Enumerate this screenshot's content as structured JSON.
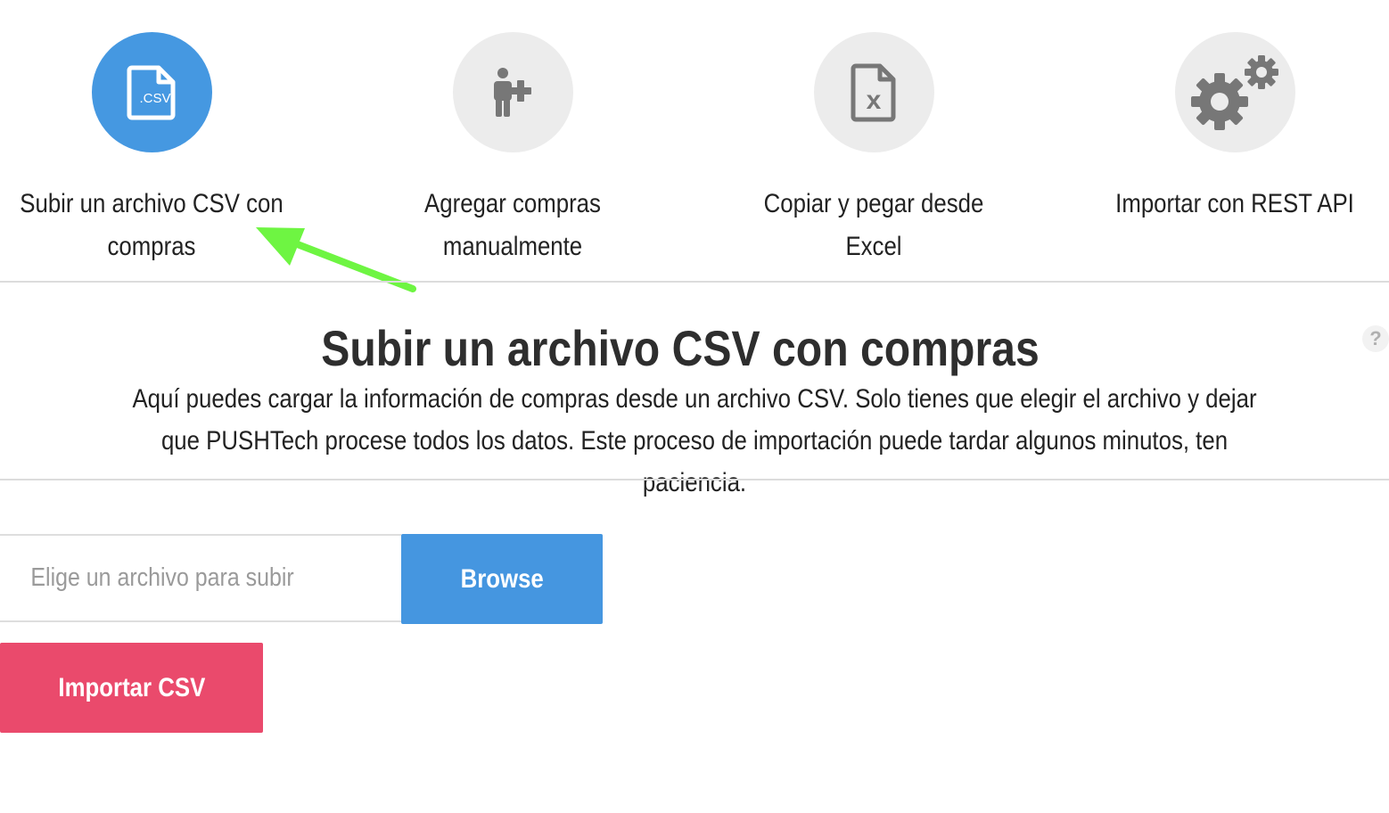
{
  "options": [
    {
      "label": "Subir un archivo CSV con compras",
      "icon": "csv-file-icon",
      "active": true
    },
    {
      "label": "Agregar compras manualmente",
      "icon": "add-user-icon",
      "active": false
    },
    {
      "label": "Copiar y pegar desde Excel",
      "icon": "excel-file-icon",
      "active": false
    },
    {
      "label": "Importar con REST API",
      "icon": "gears-icon",
      "active": false
    }
  ],
  "csv_icon_text": ".CSV",
  "excel_icon_text": "x",
  "section": {
    "title": "Subir un archivo CSV con compras",
    "description": "Aquí puedes cargar la información de compras desde un archivo CSV. Solo tienes que elegir el archivo y dejar que PUSHTech procese todos los datos. Este proceso de importación puede tardar algunos minutos, ten paciencia.",
    "help": "?"
  },
  "form": {
    "file_placeholder": "Elige un archivo para subir",
    "file_value": "",
    "browse_label": "Browse",
    "import_label": "Importar CSV"
  },
  "colors": {
    "active_circle": "#4598e1",
    "inactive_circle": "#ececec",
    "icon_gray": "#777777",
    "browse_button": "#4596e0",
    "import_button": "#ea4a6c",
    "annotation_arrow": "#6ef542"
  }
}
